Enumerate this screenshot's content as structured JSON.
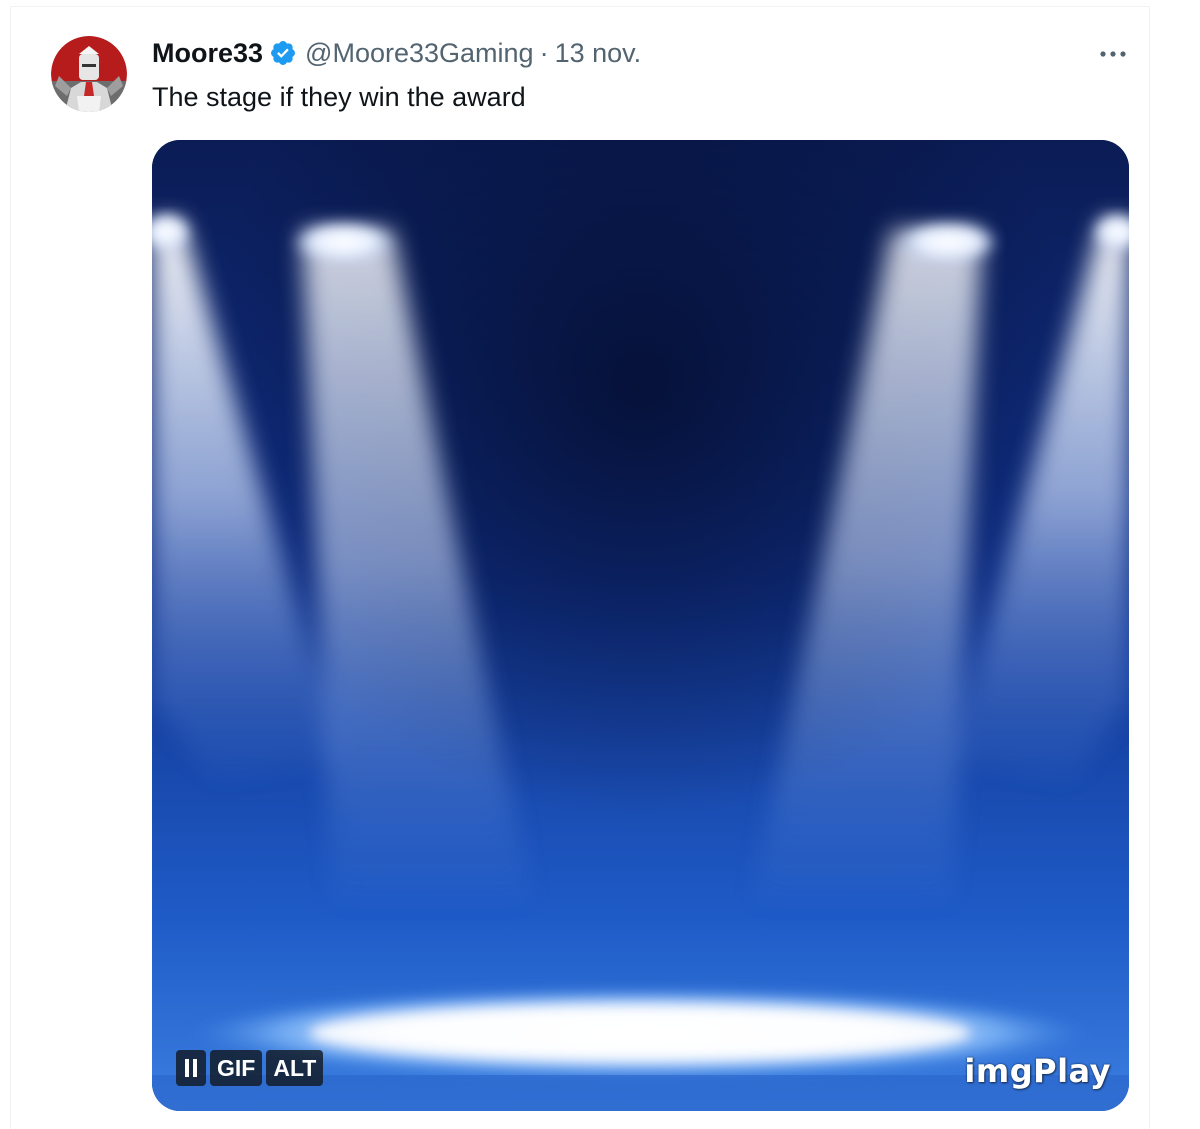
{
  "tweet": {
    "author": {
      "display_name": "Moore33",
      "verified": true,
      "handle": "@Moore33Gaming",
      "avatar_icon": "avatar-knight"
    },
    "separator": "·",
    "timestamp": "13 nov.",
    "more_icon": "more-options-icon",
    "text": "The stage if they win the award",
    "media": {
      "type": "gif",
      "description_icon": "spotlight-stage",
      "controls": {
        "pause_icon": "pause-icon",
        "gif_label": "GIF",
        "alt_label": "ALT"
      },
      "watermark": "imgPlay"
    }
  },
  "colors": {
    "text_primary": "#0f1419",
    "text_secondary": "#536471",
    "verified_blue": "#1d9bf0",
    "border": "#eff3f4"
  }
}
